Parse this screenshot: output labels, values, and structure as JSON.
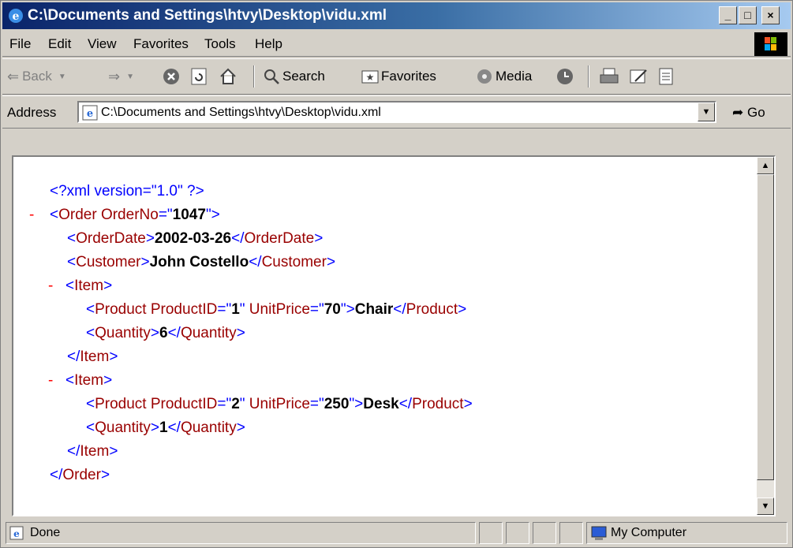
{
  "window": {
    "title": "C:\\Documents and Settings\\htvy\\Desktop\\vidu.xml",
    "min": "_",
    "max": "□",
    "close": "×"
  },
  "menu": [
    "File",
    "Edit",
    "View",
    "Favorites",
    "Tools",
    "Help"
  ],
  "toolbar": {
    "back": "Back",
    "search": "Search",
    "favorites": "Favorites",
    "media": "Media"
  },
  "address": {
    "label": "Address",
    "value": "C:\\Documents and Settings\\htvy\\Desktop\\vidu.xml",
    "go": "Go"
  },
  "xml": {
    "pi": "<?xml version=\"1.0\" ?>",
    "order_no": "1047",
    "order_date": "2002-03-26",
    "customer": "John Costello",
    "items": [
      {
        "product_id": "1",
        "unit_price": "70",
        "product": "Chair",
        "quantity": "6"
      },
      {
        "product_id": "2",
        "unit_price": "250",
        "product": "Desk",
        "quantity": "1"
      }
    ]
  },
  "status": {
    "text": "Done",
    "zone": "My Computer"
  },
  "colors": {
    "title_start": "#0a246a",
    "title_end": "#a6caf0",
    "tag": "#0000ff",
    "name": "#990000",
    "minus": "#ff0000"
  },
  "icons": [
    "ie-icon",
    "back-icon",
    "forward-icon",
    "stop-icon",
    "refresh-icon",
    "home-icon",
    "search-icon",
    "favorites-icon",
    "media-icon",
    "history-icon",
    "print-icon",
    "edit-icon",
    "discuss-icon",
    "windows-logo-icon",
    "go-arrow-icon",
    "computer-icon"
  ]
}
